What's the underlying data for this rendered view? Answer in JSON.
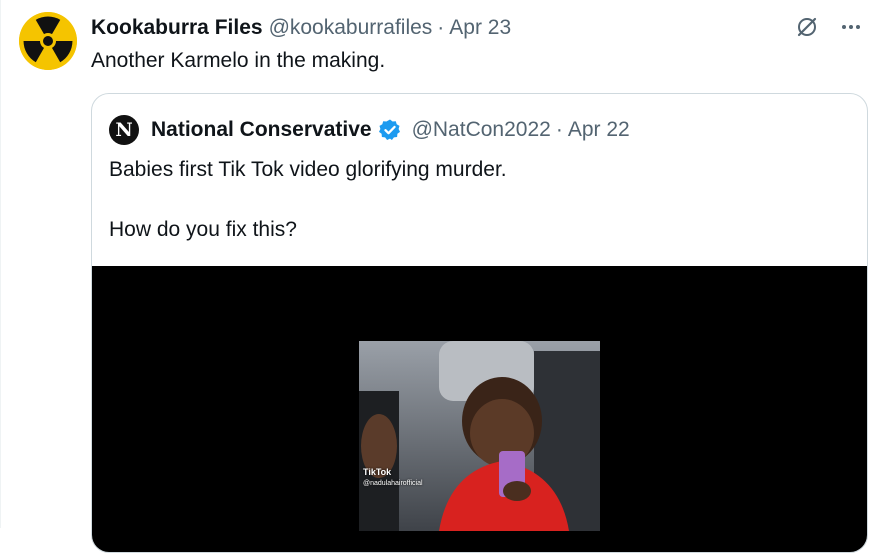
{
  "tweet": {
    "display_name": "Kookaburra Files",
    "handle": "@kookaburrafiles",
    "separator": "·",
    "date": "Apr 23",
    "text": "Another Karmelo in the making.",
    "avatar_icon": "radiation-icon"
  },
  "quoted_tweet": {
    "display_name": "National Conservative",
    "avatar_letter": "N",
    "handle": "@NatCon2022",
    "separator": "·",
    "date": "Apr 22",
    "text_line1": "Babies first Tik Tok video glorifying murder.",
    "text_line2": "How do you fix this?",
    "media": {
      "watermark": "TikTok",
      "watermark_handle": "@nadulahairofficial"
    }
  },
  "colors": {
    "avatar_yellow": "#f5c400",
    "verified_blue": "#1d9bf0",
    "muted_text": "#536471"
  }
}
